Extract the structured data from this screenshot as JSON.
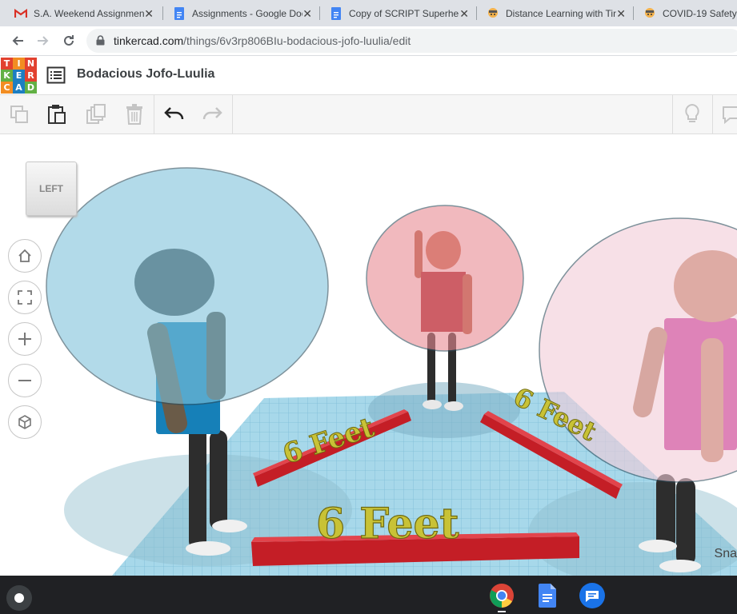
{
  "browser": {
    "tabs": [
      {
        "title": "S.A. Weekend Assignment",
        "icon": "gmail-icon",
        "close": "✕"
      },
      {
        "title": "Assignments - Google Docs",
        "icon": "google-docs-icon",
        "close": "✕"
      },
      {
        "title": "Copy of SCRIPT Superhero",
        "icon": "google-docs-icon",
        "close": "✕"
      },
      {
        "title": "Distance Learning with Tinkercad",
        "icon": "tinkercad-avatar-icon",
        "close": "✕"
      },
      {
        "title": "COVID-19 Safety",
        "icon": "tinkercad-avatar-icon",
        "close": ""
      }
    ],
    "url_host": "tinkercad.com",
    "url_path": "/things/6v3rp806BIu-bodacious-jofo-luulia/edit"
  },
  "app": {
    "logo_letters": [
      "T",
      "I",
      "N",
      "K",
      "E",
      "R",
      "C",
      "A",
      "D"
    ],
    "logo_colors": [
      "#e2412f",
      "#f28d22",
      "#e2412f",
      "#62b044",
      "#1d7ec1",
      "#e2412f",
      "#f28d22",
      "#1d7ec1",
      "#62b044"
    ],
    "design_title": "Bodacious Jofo-Luulia"
  },
  "toolbar": {
    "copy_icon": "copy-icon",
    "paste_icon": "paste-icon",
    "duplicate_icon": "duplicate-icon",
    "delete_icon": "trash-icon",
    "undo_icon": "undo-icon",
    "redo_icon": "redo-icon",
    "lightbulb_icon": "lightbulb-icon",
    "notes_icon": "notes-icon"
  },
  "viewport": {
    "viewcube_label": "LEFT",
    "labels": [
      "6 Feet",
      "6 Feet",
      "6 Feet"
    ],
    "snap_text": "Sna",
    "colors": {
      "grid": "#9fd3e6",
      "bar": "#d2232a",
      "text3d": "#c8c236",
      "bubble_left": "#7fc3dc",
      "bubble_center": "#e88b93",
      "bubble_right": "#f2ccd8",
      "shirt_blue": "#1680b8",
      "shirt_red": "#b21c24",
      "shirt_magenta": "#c0168a"
    }
  },
  "view_controls": [
    "home-view-icon",
    "fit-view-icon",
    "zoom-in-icon",
    "zoom-out-icon",
    "perspective-icon"
  ],
  "shelf": {
    "apps": [
      "chrome-icon",
      "google-docs-icon",
      "messages-icon"
    ]
  }
}
